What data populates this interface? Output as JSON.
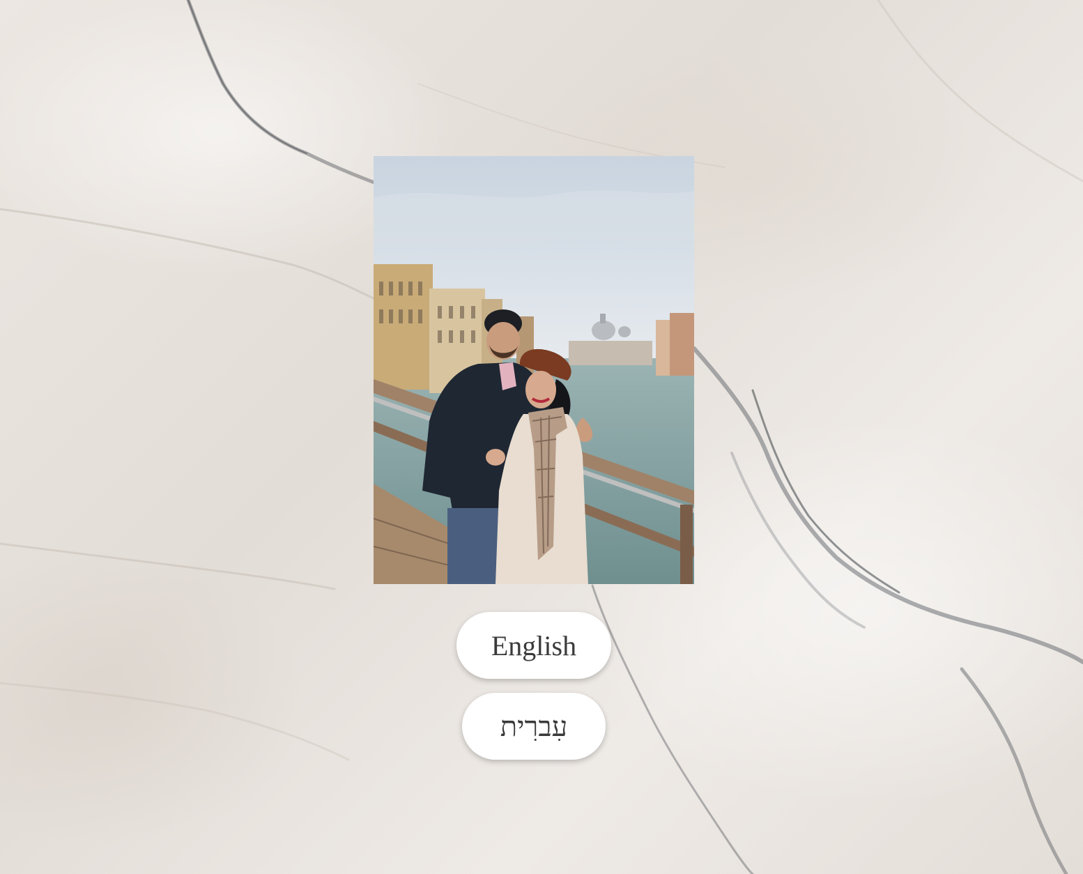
{
  "colors": {
    "background": "#e9e4df",
    "button_bg": "#ffffff",
    "button_text": "#3a3a3a"
  },
  "photo": {
    "description_icon": "couple-venice-photo"
  },
  "language_buttons": {
    "english_label": "English",
    "hebrew_label": "עִברִית"
  }
}
